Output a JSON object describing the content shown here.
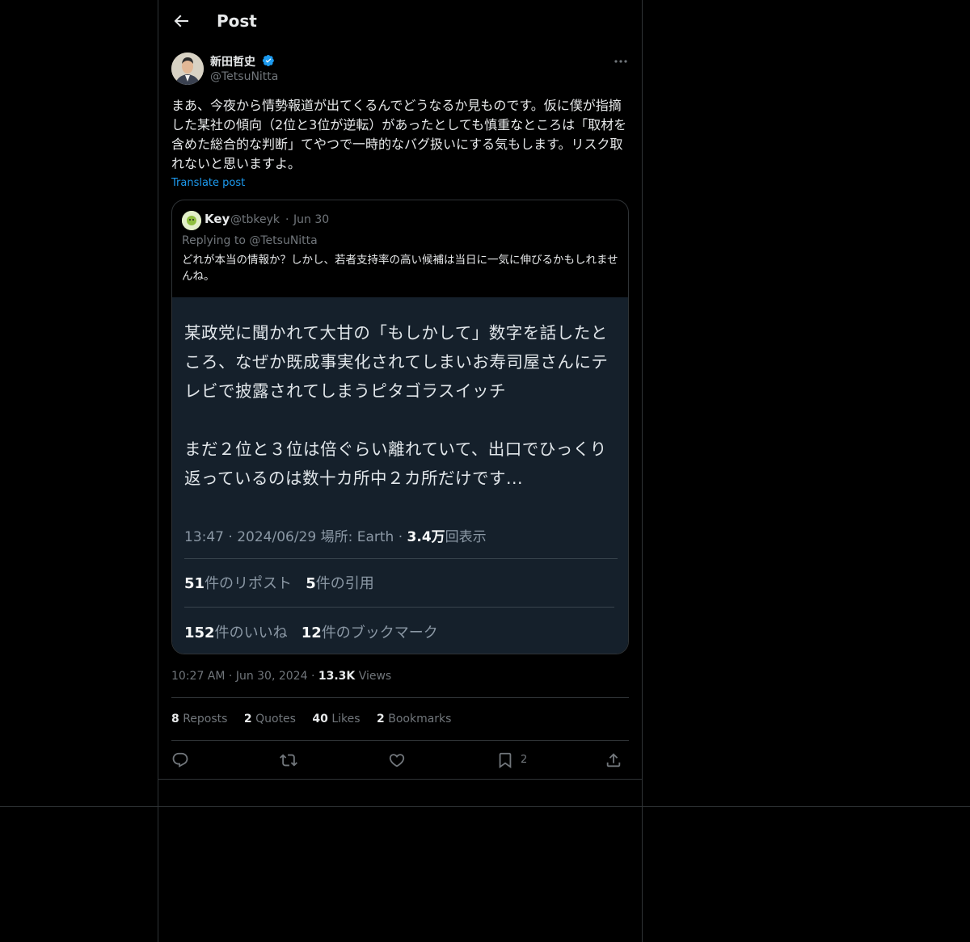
{
  "header": {
    "title": "Post"
  },
  "post": {
    "author_name": "新田哲史",
    "author_handle": "@TetsuNitta",
    "text": "まあ、今夜から情勢報道が出てくるんでどうなるか見ものです。仮に僕が指摘した某社の傾向（2位と3位が逆転）があったとしても慎重なところは「取材を含めた総合的な判断」てやつで一時的なバグ扱いにする気もします。リスク取れないと思いますよ。",
    "translate_label": "Translate post",
    "time": "10:27 AM",
    "date": "Jun 30, 2024",
    "views_count": "13.3K",
    "views_label": "Views",
    "stats": {
      "reposts_count": "8",
      "reposts_label": "Reposts",
      "quotes_count": "2",
      "quotes_label": "Quotes",
      "likes_count": "40",
      "likes_label": "Likes",
      "bookmarks_count": "2",
      "bookmarks_label": "Bookmarks"
    },
    "action_bookmark_count": "2"
  },
  "quote": {
    "name": "Key",
    "handle": "@tbkeyk",
    "date": "Jun 30",
    "replying": "Replying to @TetsuNitta",
    "text": "どれが本当の情報か？しかし、若者支持率の高い候補は当日に一気に伸びるかもしれませんね。",
    "screenshot": {
      "para1": "某政党に聞かれて大甘の「もしかして」数字を話したところ、なぜか既成事実化されてしまいお寿司屋さんにテレビで披露されてしまうピタゴラスイッチ",
      "para2": "まだ２位と３位は倍ぐらい離れていて、出口でひっくり返っているのは数十カ所中２カ所だけです...",
      "meta_prefix": "13:47 · 2024/06/29 場所: Earth · ",
      "meta_views": "3.4万",
      "meta_suffix": "回表示",
      "reposts_count": "51",
      "reposts_label": "件のリポスト",
      "quotes_count": "5",
      "quotes_label": "件の引用",
      "likes_count": "152",
      "likes_label": "件のいいね",
      "bookmarks_count": "12",
      "bookmarks_label": "件のブックマーク"
    }
  },
  "icons": {
    "back": "arrow-left-icon",
    "verified": "verified-badge-icon",
    "more": "more-icon",
    "reply": "reply-icon",
    "repost": "repost-icon",
    "like": "like-icon",
    "bookmark": "bookmark-icon",
    "share": "share-icon"
  },
  "colors": {
    "accent": "#1d9bf0",
    "background": "#000000",
    "muted": "#71767b"
  }
}
